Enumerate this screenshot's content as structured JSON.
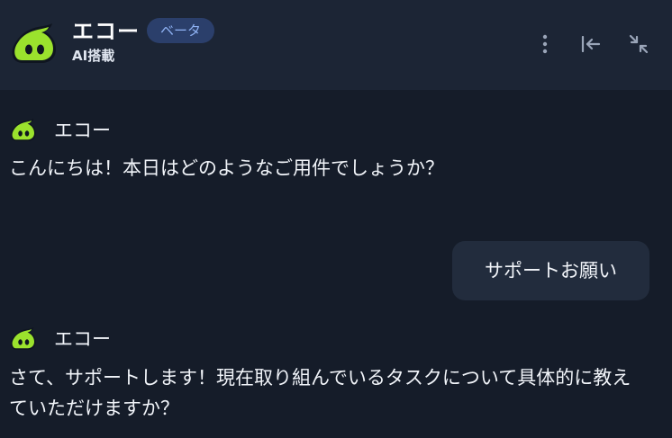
{
  "header": {
    "title": "エコー",
    "badge": "ベータ",
    "subtitle": "AI搭載",
    "icons": {
      "menu": "more-vertical-icon",
      "collapse": "collapse-left-icon",
      "minimize": "minimize-icon"
    }
  },
  "messages": [
    {
      "role": "bot",
      "name": "エコー",
      "text": "こんにちは！本日はどのようなご用件でしょうか？"
    },
    {
      "role": "user",
      "text": "サポートお願い"
    },
    {
      "role": "bot",
      "name": "エコー",
      "text": "さて、サポートします！現在取り組んでいるタスクについて具体的に教えていただけますか？"
    }
  ],
  "colors": {
    "background": "#151c29",
    "header": "#1c2535",
    "badge_bg": "#2b3f6b",
    "badge_text": "#8fb2f4",
    "user_bubble": "#222c3d",
    "logo_green": "#9be22d"
  }
}
